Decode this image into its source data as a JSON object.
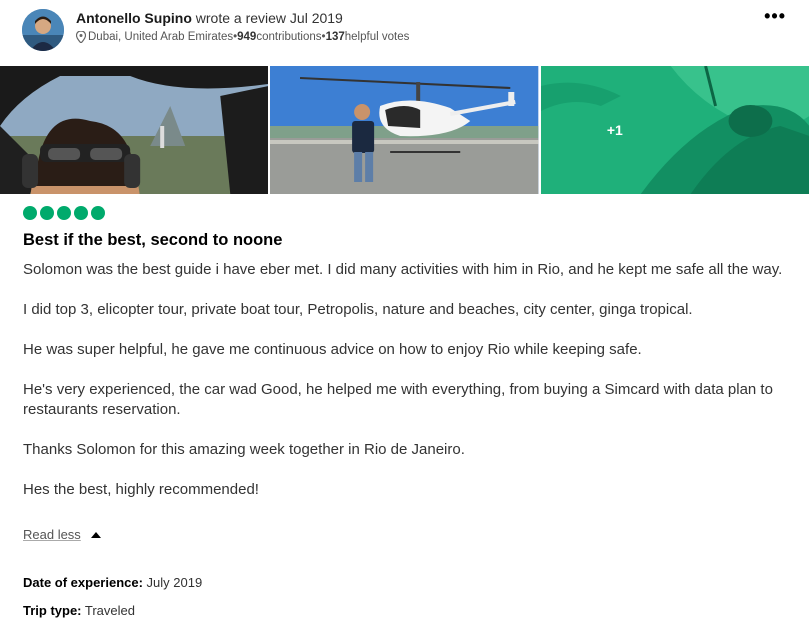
{
  "review": {
    "author_name": "Antonello Supino",
    "action_text": " wrote a review Jul 2019",
    "location": "Dubai, United Arab Emirates",
    "meta_sep": " • ",
    "contributions_count": "949",
    "contributions_label": " contributions",
    "helpful_count": "137",
    "helpful_label": " helpful votes",
    "more_label": "•••",
    "photos_extra": "+1",
    "rating": 5,
    "title": "Best if the best, second to noone",
    "paragraphs": [
      "Solomon was the best guide i have eber met. I did many activities with him in Rio, and he kept me safe all the way.",
      "I did top 3, elicopter tour, private boat tour, Petropolis, nature and beaches, city center, ginga tropical.",
      "He was super helpful, he gave me continuous advice on how to enjoy Rio while keeping safe.",
      "He's very experienced, the car wad Good, he helped me with everything, from buying a Simcard with data plan to restaurants reservation.",
      "Thanks Solomon for this amazing week together in Rio de Janeiro.",
      "Hes the best, highly recommended!"
    ],
    "read_less": "Read less",
    "date_label": "Date of experience:",
    "date_value": " July 2019",
    "trip_label": "Trip type:",
    "trip_value": " Traveled"
  },
  "colors": {
    "rating_bubble": "#00aa6c",
    "photo_overlay": "#1fb07a"
  },
  "icons": {
    "location": "map-pin-icon",
    "more": "ellipsis-icon",
    "read_less": "caret-up-icon"
  }
}
